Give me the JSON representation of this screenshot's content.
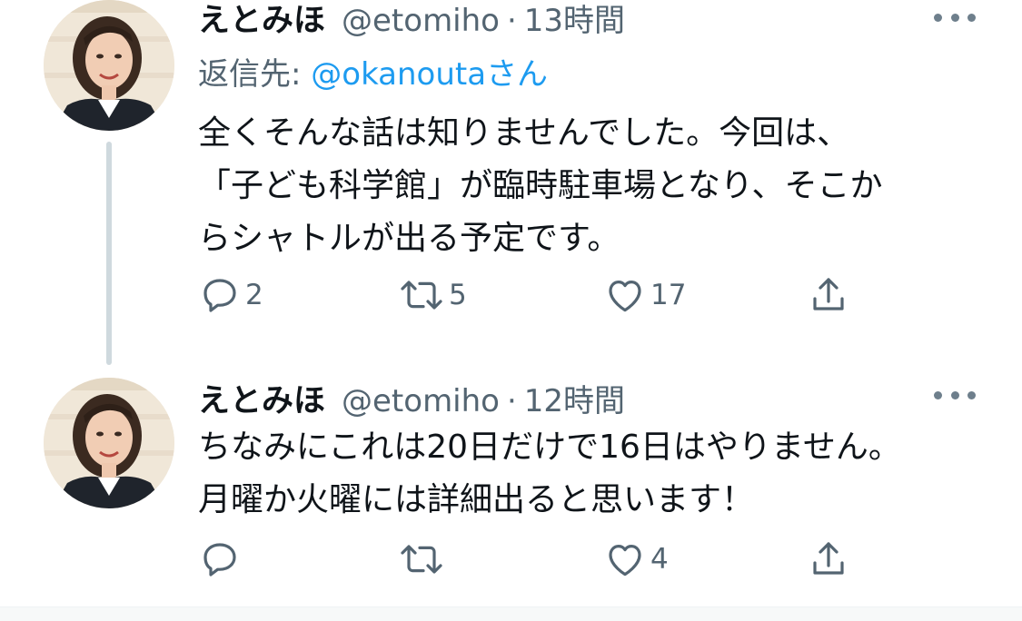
{
  "tweets": [
    {
      "display_name": "えとみほ",
      "handle": "@etomiho",
      "separator": "·",
      "time": "13時間",
      "reply_to": {
        "prefix": "返信先: ",
        "mention": "@okanouta",
        "suffix": "さん"
      },
      "body_lines": [
        "全くそんな話は知りませんでした。今回は、",
        "「子ども科学館」が臨時駐車場となり、そこか",
        "らシャトルが出る予定です。"
      ],
      "actions": {
        "reply_count": "2",
        "retweet_count": "5",
        "like_count": "17"
      }
    },
    {
      "display_name": "えとみほ",
      "handle": "@etomiho",
      "separator": "·",
      "time": "12時間",
      "body_lines": [
        "ちなみにこれは20日だけで16日はやりません。",
        "月曜か火曜には詳細出ると思います！"
      ],
      "actions": {
        "reply_count": "",
        "retweet_count": "",
        "like_count": "4"
      }
    }
  ],
  "icons": {
    "more": "more-horizontal-icon",
    "reply": "reply-bubble-icon",
    "retweet": "retweet-icon",
    "like": "heart-icon",
    "share": "share-icon"
  },
  "colors": {
    "text_primary": "#0f1419",
    "text_secondary": "#536471",
    "mention_link": "#1d9bf0",
    "icon": "#536471",
    "thread_line": "#cfd9de"
  }
}
